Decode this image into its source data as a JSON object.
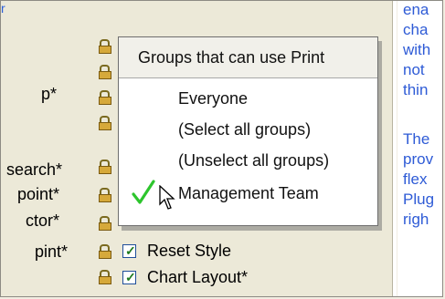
{
  "help_text": {
    "lines": [
      "ena",
      "cha",
      "with",
      "not",
      "thin",
      "The",
      "prov",
      "flex",
      "Plug",
      "righ"
    ]
  },
  "permissions": {
    "rows": [
      {
        "label": "",
        "checked": false,
        "has_checkbox": false
      },
      {
        "label": "",
        "checked": false,
        "has_checkbox": false
      },
      {
        "label": "p*",
        "checked": false,
        "has_checkbox": false
      },
      {
        "label": "",
        "checked": false,
        "has_checkbox": false
      },
      {
        "label": "search*",
        "checked": false,
        "has_checkbox": false
      },
      {
        "label": "point*",
        "checked": false,
        "has_checkbox": false
      },
      {
        "label": "ctor*",
        "checked": false,
        "has_checkbox": false
      },
      {
        "label": "pint*",
        "checked": true,
        "has_checkbox": true,
        "item": "Reset Style"
      },
      {
        "label": "",
        "checked": true,
        "has_checkbox": true,
        "item": "Chart Layout*"
      }
    ]
  },
  "popup": {
    "title": "Groups that can use Print",
    "items": [
      {
        "label": "Everyone",
        "checked": false
      },
      {
        "label": "(Select all groups)",
        "checked": false
      },
      {
        "label": "(Unselect all groups)",
        "checked": false
      },
      {
        "label": "Management Team",
        "checked": true
      }
    ]
  },
  "colors": {
    "panel_bg": "#ece9d8",
    "link_blue": "#2e5bd6",
    "check_green": "#2dc52d"
  },
  "icons": {
    "lock": "lock-icon",
    "checkbox": "checkbox-icon",
    "check": "green-checkmark-icon",
    "cursor": "mouse-pointer-icon"
  }
}
